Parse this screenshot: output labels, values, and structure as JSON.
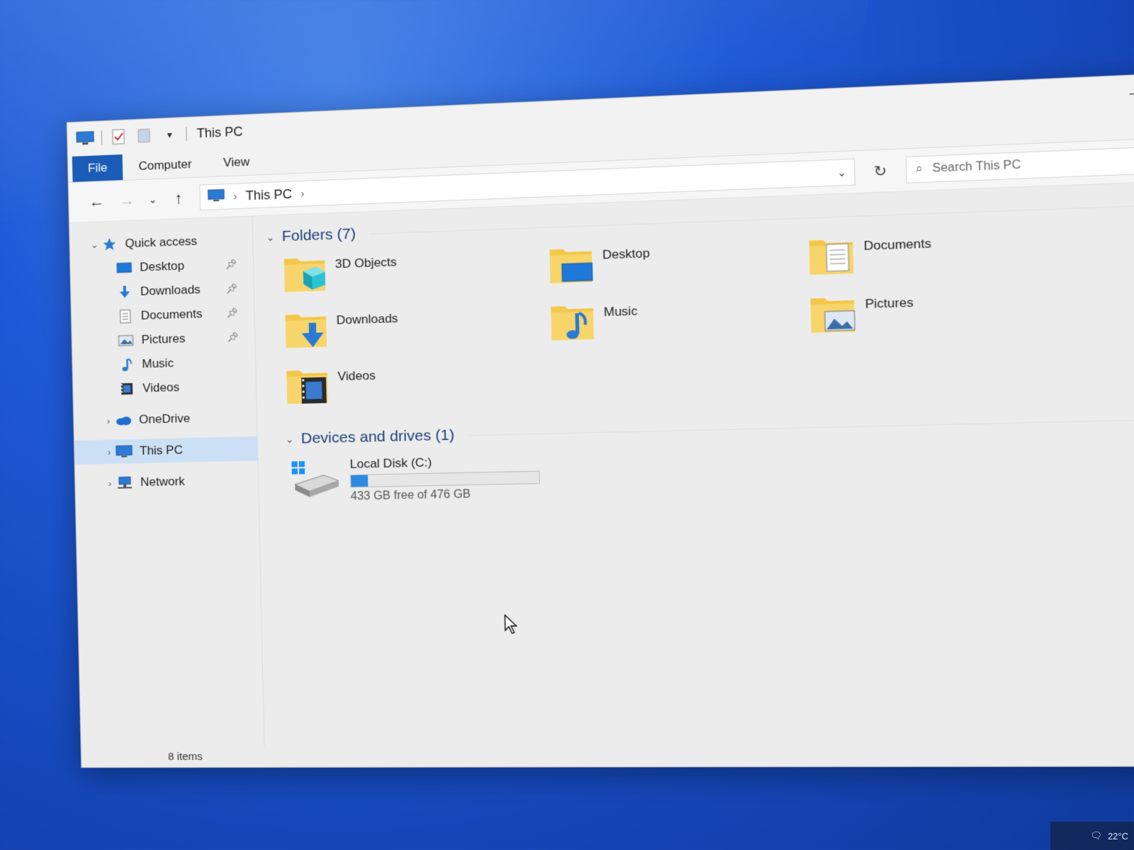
{
  "window": {
    "title": "This PC",
    "minimize_glyph": "–",
    "maximize_glyph": "☐"
  },
  "ribbon": {
    "tabs": [
      "File",
      "Computer",
      "View"
    ]
  },
  "address_bar": {
    "path": [
      "This PC"
    ],
    "search_placeholder": "Search This PC"
  },
  "nav_pane": {
    "quick_access": {
      "label": "Quick access",
      "items": [
        {
          "label": "Desktop",
          "pinned": true
        },
        {
          "label": "Downloads",
          "pinned": true
        },
        {
          "label": "Documents",
          "pinned": true
        },
        {
          "label": "Pictures",
          "pinned": true
        },
        {
          "label": "Music",
          "pinned": false
        },
        {
          "label": "Videos",
          "pinned": false
        }
      ]
    },
    "roots": [
      {
        "label": "OneDrive"
      },
      {
        "label": "This PC",
        "selected": true
      },
      {
        "label": "Network"
      }
    ]
  },
  "content": {
    "folders_header": "Folders (7)",
    "folders": [
      {
        "label": "3D Objects",
        "icon": "3d-objects-icon"
      },
      {
        "label": "Desktop",
        "icon": "desktop-icon"
      },
      {
        "label": "Documents",
        "icon": "documents-icon"
      },
      {
        "label": "Downloads",
        "icon": "downloads-icon"
      },
      {
        "label": "Music",
        "icon": "music-icon"
      },
      {
        "label": "Pictures",
        "icon": "pictures-icon"
      },
      {
        "label": "Videos",
        "icon": "videos-icon"
      }
    ],
    "drives_header": "Devices and drives (1)",
    "drives": [
      {
        "name": "Local Disk (C:)",
        "free_text": "433 GB free of 476 GB",
        "used_fraction": 0.09
      }
    ]
  },
  "status": {
    "item_count": "8 items"
  },
  "taskbar": {
    "temperature": "22°C"
  },
  "colors": {
    "accent": "#1a5cb8",
    "selection": "#cce0f5",
    "folder_yellow": "#f3c74a",
    "drive_bar": "#2a8be0"
  }
}
